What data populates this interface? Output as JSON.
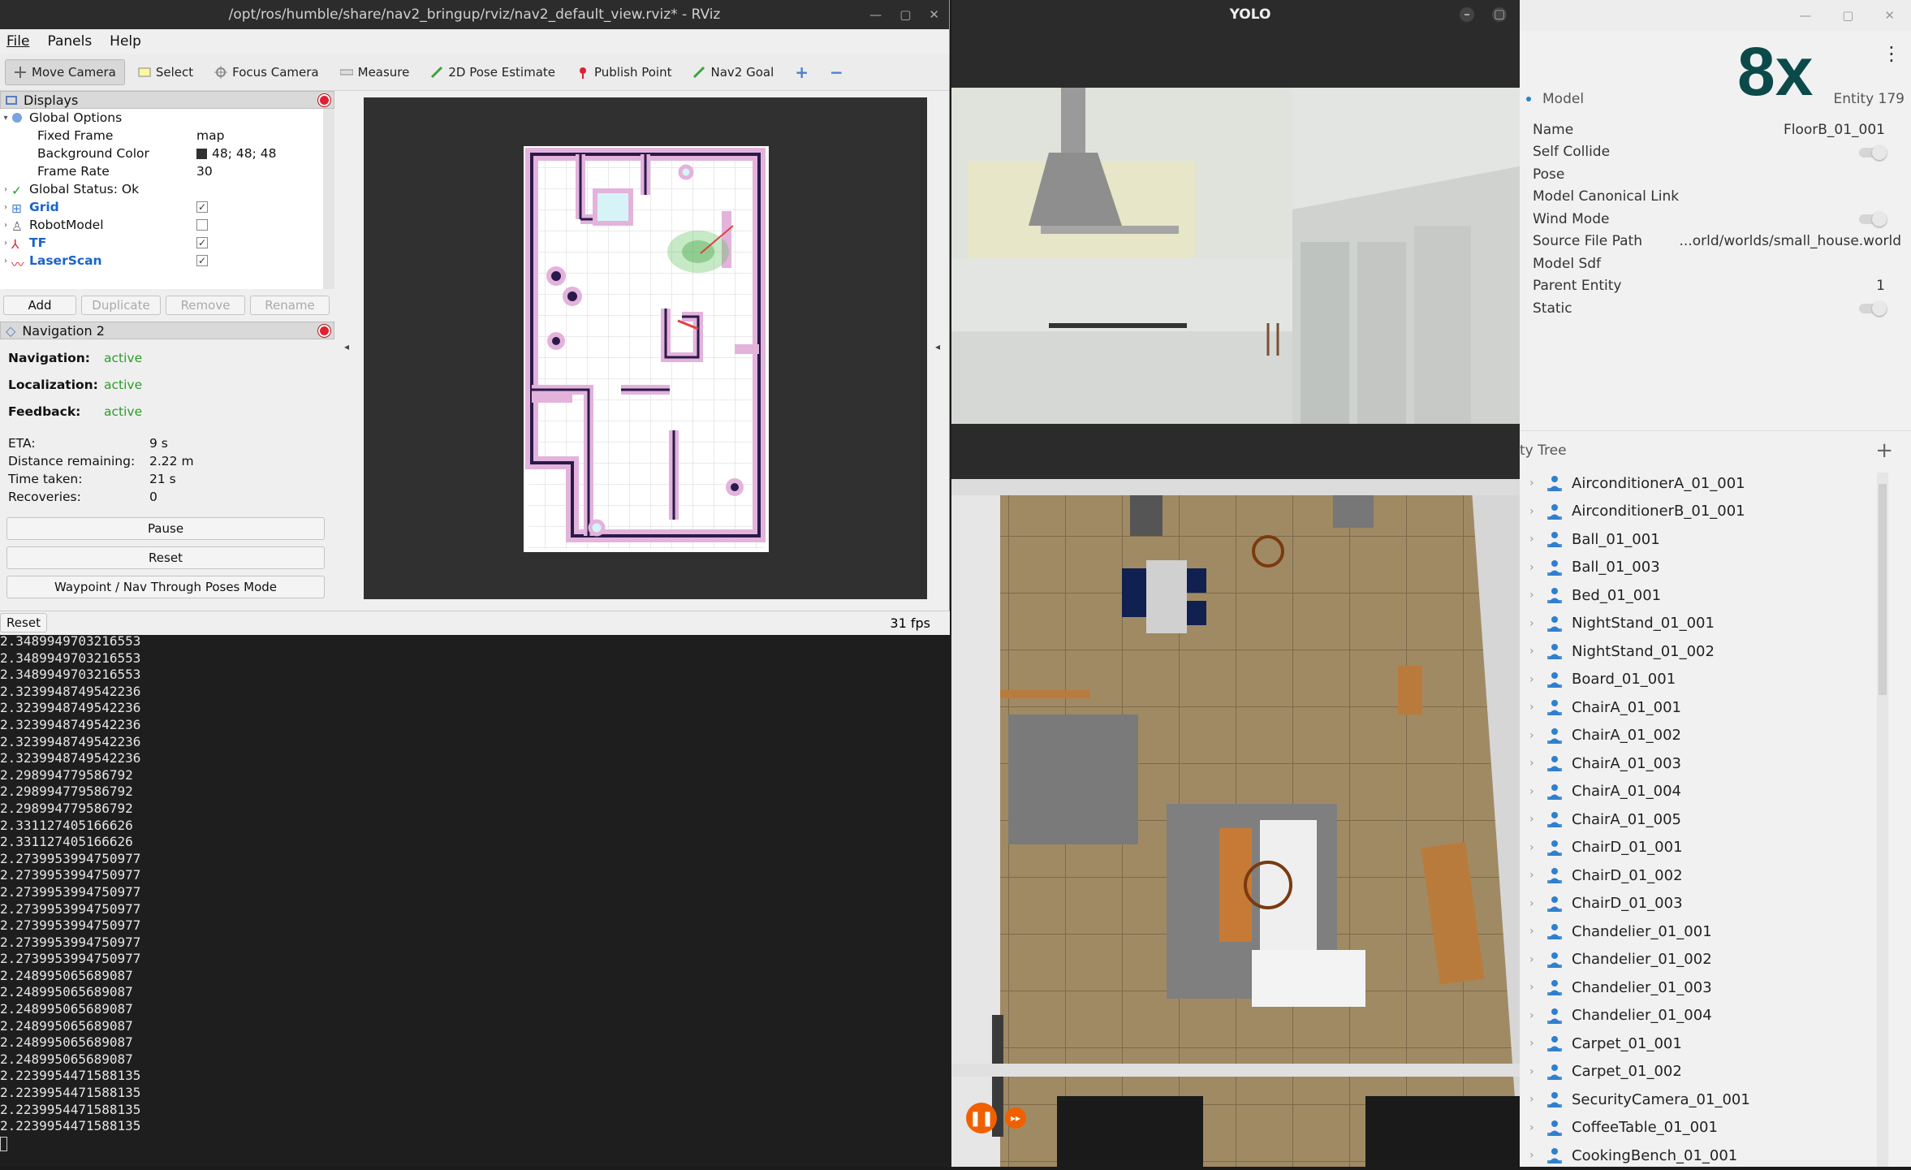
{
  "rviz": {
    "title": "/opt/ros/humble/share/nav2_bringup/rviz/nav2_default_view.rviz* - RViz",
    "menu": [
      "File",
      "Panels",
      "Help"
    ],
    "tools": [
      "Move Camera",
      "Select",
      "Focus Camera",
      "Measure",
      "2D Pose Estimate",
      "Publish Point",
      "Nav2 Goal"
    ],
    "displays_header": "Displays",
    "displays": {
      "global_options": "Global Options",
      "fixed_frame_label": "Fixed Frame",
      "fixed_frame_value": "map",
      "bg_color_label": "Background Color",
      "bg_color_value": "48; 48; 48",
      "frame_rate_label": "Frame Rate",
      "frame_rate_value": "30",
      "global_status": "Global Status: Ok",
      "grid": "Grid",
      "robot_model": "RobotModel",
      "tf": "TF",
      "laser_scan": "LaserScan"
    },
    "display_buttons": [
      "Add",
      "Duplicate",
      "Remove",
      "Rename"
    ],
    "nav_header": "Navigation 2",
    "nav": {
      "navigation_label": "Navigation:",
      "navigation_value": "active",
      "localization_label": "Localization:",
      "localization_value": "active",
      "feedback_label": "Feedback:",
      "feedback_value": "active",
      "eta_label": "ETA:",
      "eta_value": "9 s",
      "distance_label": "Distance remaining:",
      "distance_value": "2.22 m",
      "time_label": "Time taken:",
      "time_value": "21 s",
      "recoveries_label": "Recoveries:",
      "recoveries_value": "0",
      "pause": "Pause",
      "reset": "Reset",
      "waypoint": "Waypoint / Nav Through Poses Mode"
    },
    "status_reset": "Reset",
    "fps": "31 fps"
  },
  "terminal": {
    "lines": [
      "2.3489949703216553",
      "2.3489949703216553",
      "2.3489949703216553",
      "2.3239948749542236",
      "2.3239948749542236",
      "2.3239948749542236",
      "2.3239948749542236",
      "2.3239948749542236",
      "2.298994779586792",
      "2.298994779586792",
      "2.298994779586792",
      "2.331127405166626",
      "2.331127405166626",
      "2.2739953994750977",
      "2.2739953994750977",
      "2.2739953994750977",
      "2.2739953994750977",
      "2.2739953994750977",
      "2.2739953994750977",
      "2.2739953994750977",
      "2.248995065689087",
      "2.248995065689087",
      "2.248995065689087",
      "2.248995065689087",
      "2.248995065689087",
      "2.248995065689087",
      "2.2239954471588135",
      "2.2239954471588135",
      "2.2239954471588135",
      "2.2239954471588135"
    ]
  },
  "yolo": {
    "title": "YOLO"
  },
  "gazebo": {
    "speed_badge": "8x",
    "model_header": "Model",
    "entity_label": "Entity 179",
    "props": {
      "name_label": "Name",
      "name_value": "FloorB_01_001",
      "self_collide": "Self Collide",
      "pose": "Pose",
      "canonical_link": "Model Canonical Link",
      "wind_mode": "Wind Mode",
      "source_label": "Source File Path",
      "source_value": "...orld/worlds/small_house.world",
      "model_sdf": "Model Sdf",
      "parent_label": "Parent Entity",
      "parent_value": "1",
      "static": "Static"
    },
    "tree_header": "ty Tree",
    "entities": [
      "AirconditionerA_01_001",
      "AirconditionerB_01_001",
      "Ball_01_001",
      "Ball_01_003",
      "Bed_01_001",
      "NightStand_01_001",
      "NightStand_01_002",
      "Board_01_001",
      "ChairA_01_001",
      "ChairA_01_002",
      "ChairA_01_003",
      "ChairA_01_004",
      "ChairA_01_005",
      "ChairD_01_001",
      "ChairD_01_002",
      "ChairD_01_003",
      "Chandelier_01_001",
      "Chandelier_01_002",
      "Chandelier_01_003",
      "Chandelier_01_004",
      "Carpet_01_001",
      "Carpet_01_002",
      "SecurityCamera_01_001",
      "CoffeeTable_01_001",
      "CookingBench_01_001"
    ],
    "colors": {
      "accent": "#1a64c8",
      "person_icon": "#2f7fd0"
    }
  }
}
